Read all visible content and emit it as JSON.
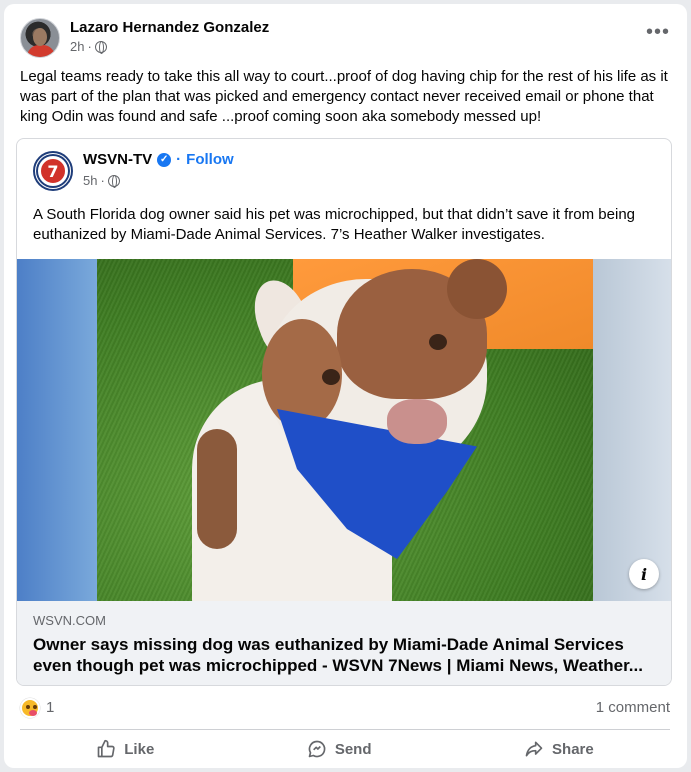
{
  "post": {
    "author": "Lazaro Hernandez Gonzalez",
    "time": "2h",
    "separator": "·",
    "more_label": "•••",
    "text": "Legal teams ready to take this all way to court...proof of dog having chip for the rest of his life as it was part of the plan that was picked and emergency contact never received email or phone that king Odin was found and safe ...proof coming soon aka somebody messed up!"
  },
  "shared": {
    "page_name": "WSVN-TV",
    "logo_text": "7",
    "follow_separator": "·",
    "follow_label": "Follow",
    "time": "5h",
    "separator": "·",
    "text": "A South Florida dog owner said his pet was microchipped, but that didn’t save it from being euthanized by Miami-Dade Animal Services. 7’s Heather Walker investigates.",
    "info_label": "i",
    "link": {
      "domain": "WSVN.COM",
      "title": "Owner says missing dog was euthanized by Miami-Dade Animal Services even though pet was microchipped - WSVN 7News | Miami News, Weather..."
    }
  },
  "engagement": {
    "reaction_count": "1",
    "comments": "1 comment"
  },
  "actions": {
    "like": "Like",
    "send": "Send",
    "share": "Share"
  },
  "colors": {
    "accent": "#1877f2",
    "secondary_text": "#65676b",
    "link_box_bg": "#f0f2f5"
  },
  "icons": [
    "more-options-icon",
    "globe-icon",
    "verified-icon",
    "info-icon",
    "like-icon",
    "send-icon",
    "share-icon",
    "haha-reaction-icon"
  ]
}
